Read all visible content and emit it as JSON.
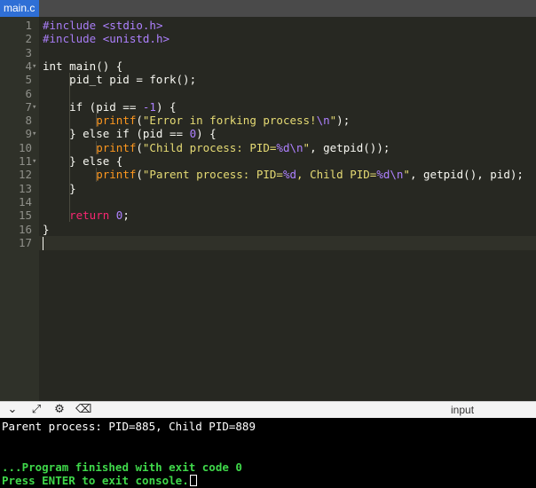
{
  "tab": {
    "filename": "main.c"
  },
  "editor": {
    "lines": [
      {
        "n": "1",
        "fold": "",
        "html": "<span class='pp'>#include</span> <span class='inc'>&lt;stdio.h&gt;</span>"
      },
      {
        "n": "2",
        "fold": "",
        "html": "<span class='pp'>#include</span> <span class='inc'>&lt;unistd.h&gt;</span>"
      },
      {
        "n": "3",
        "fold": "",
        "html": ""
      },
      {
        "n": "4",
        "fold": "▾",
        "html": "int main() {"
      },
      {
        "n": "5",
        "fold": "",
        "html": "    pid_t pid = fork();"
      },
      {
        "n": "6",
        "fold": "",
        "html": ""
      },
      {
        "n": "7",
        "fold": "▾",
        "html": "    if (pid == <span class='num'>-1</span>) {"
      },
      {
        "n": "8",
        "fold": "",
        "html": "        <span class='fn'>printf</span>(<span class='str'>\"Error in forking process!<span class='esc'>\\n</span>\"</span>);"
      },
      {
        "n": "9",
        "fold": "▾",
        "html": "    } else if (pid == <span class='num'>0</span>) {"
      },
      {
        "n": "10",
        "fold": "",
        "html": "        <span class='fn'>printf</span>(<span class='str'>\"Child process: PID=<span class='esc'>%d\\n</span>\"</span>, getpid());"
      },
      {
        "n": "11",
        "fold": "▾",
        "html": "    } else {"
      },
      {
        "n": "12",
        "fold": "",
        "html": "        <span class='fn'>printf</span>(<span class='str'>\"Parent process: PID=<span class='esc'>%d</span>, Child PID=<span class='esc'>%d\\n</span>\"</span>, getpid(), pid);"
      },
      {
        "n": "13",
        "fold": "",
        "html": "    }"
      },
      {
        "n": "14",
        "fold": "",
        "html": ""
      },
      {
        "n": "15",
        "fold": "",
        "html": "    <span class='ret'>return</span> <span class='num'>0</span>;"
      },
      {
        "n": "16",
        "fold": "",
        "html": "}"
      },
      {
        "n": "17",
        "fold": "",
        "html": ""
      }
    ]
  },
  "toolbar": {
    "icons": [
      "chevron-down-icon",
      "expand-icon",
      "gear-icon",
      "clear-console-icon"
    ],
    "input_label": "input"
  },
  "console": {
    "output_line": "Parent process: PID=885, Child PID=889",
    "finished_line": "...Program finished with exit code 0",
    "prompt_line": "Press ENTER to exit console."
  }
}
